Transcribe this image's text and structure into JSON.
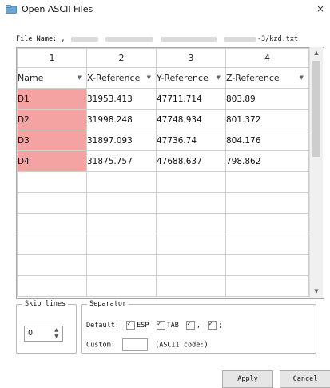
{
  "window": {
    "title": "Open ASCII Files",
    "close_glyph": "×"
  },
  "file": {
    "label": "File Name:",
    "prefix": ",",
    "suffix": "​-3/kzd.txt"
  },
  "grid": {
    "column_numbers": [
      "1",
      "2",
      "3",
      "4"
    ],
    "column_headers": [
      "Name",
      "X-Reference",
      "Y-Reference",
      "Z-Reference"
    ],
    "rows": [
      [
        "D1",
        "31953.413",
        "47711.714",
        "803.89"
      ],
      [
        "D2",
        "31998.248",
        "47748.934",
        "801.372"
      ],
      [
        "D3",
        "31897.093",
        "47736.74",
        "804.176"
      ],
      [
        "D4",
        "31875.757",
        "47688.637",
        "798.862"
      ]
    ],
    "highlight_color": "#f4a2a2"
  },
  "skip_lines": {
    "label": "Skip lines",
    "value": "0"
  },
  "separator": {
    "label": "Separator",
    "default_label": "Default:",
    "options": [
      {
        "label": "ESP",
        "checked": true
      },
      {
        "label": "TAB",
        "checked": true
      },
      {
        "label": ",",
        "checked": true
      },
      {
        "label": ";",
        "checked": true
      }
    ],
    "custom_label": "Custom:",
    "ascii_hint": "(ASCII code:)"
  },
  "buttons": {
    "apply": "Apply",
    "cancel": "Cancel"
  },
  "icons": {
    "app": "open-file-icon",
    "close": "close-icon",
    "dropdown": "chevron-down-icon"
  }
}
